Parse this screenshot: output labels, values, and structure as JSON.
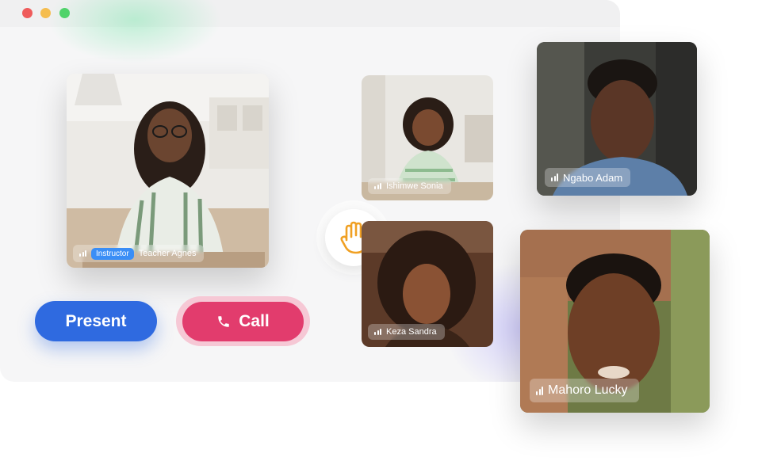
{
  "window": {
    "controls": [
      "close",
      "minimize",
      "maximize"
    ]
  },
  "participants": {
    "teacher": {
      "badge": "Instructor",
      "name": "Teacher Agnes"
    },
    "p1": {
      "name": "Ishimwe Sonia"
    },
    "p2": {
      "name": "Keza Sandra"
    },
    "p3": {
      "name": "Ngabo Adam"
    },
    "p4": {
      "name": "Mahoro Lucky"
    }
  },
  "actions": {
    "present_label": "Present",
    "call_label": "Call",
    "raise_hand_icon": "hand-icon"
  },
  "colors": {
    "present": "#2f6ae0",
    "call": "#e23c6d",
    "badge": "#3a8ef6",
    "hand": "#f0a023"
  }
}
